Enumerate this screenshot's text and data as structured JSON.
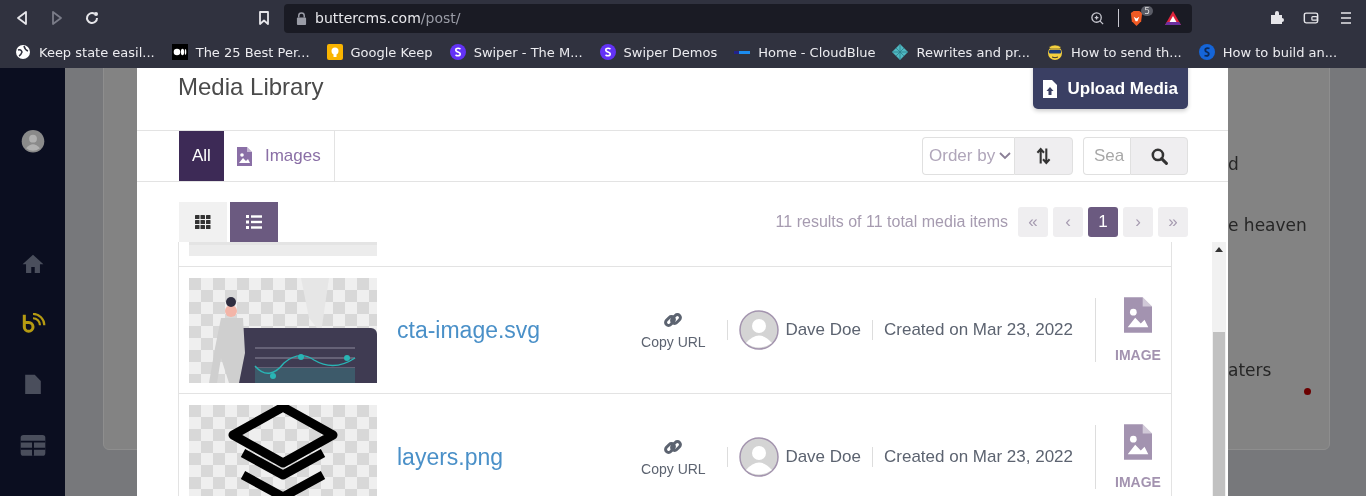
{
  "browser": {
    "url": {
      "host": "buttercms.com",
      "path": "/post/"
    },
    "shields_count": "5",
    "bookmarks": [
      {
        "label": "Keep state easil..."
      },
      {
        "label": "The 25 Best Per..."
      },
      {
        "label": "Google Keep"
      },
      {
        "label": "Swiper - The M..."
      },
      {
        "label": "Swiper Demos"
      },
      {
        "label": "Home - CloudBlue"
      },
      {
        "label": "Rewrites and pr..."
      },
      {
        "label": "How to send th..."
      },
      {
        "label": "How to build an..."
      }
    ]
  },
  "background_page": {
    "right_fragments": [
      "d",
      "e heaven",
      "aters"
    ]
  },
  "modal": {
    "title": "Media Library",
    "upload_button": "Upload Media",
    "tabs": [
      {
        "label": "All",
        "selected": true
      },
      {
        "label": "Images",
        "selected": false
      }
    ],
    "order_by": {
      "value": "Order by"
    },
    "search": {
      "placeholder": "Sea"
    },
    "views": [
      {
        "kind": "grid",
        "selected": false
      },
      {
        "kind": "list",
        "selected": true
      }
    ],
    "results": "11 results of 11 total media items",
    "pagination": [
      {
        "label": "«",
        "selected": false
      },
      {
        "label": "‹",
        "selected": false
      },
      {
        "label": "1",
        "selected": true
      },
      {
        "label": "›",
        "selected": false
      },
      {
        "label": "»",
        "selected": false
      }
    ],
    "items": [
      {
        "name": "cta-image.svg",
        "action": "Copy URL",
        "author": "Dave Doe",
        "created": "Created on Mar 23, 2022",
        "type": "IMAGE"
      },
      {
        "name": "layers.png",
        "action": "Copy URL",
        "author": "Dave Doe",
        "created": "Created on Mar 23, 2022",
        "type": "IMAGE"
      }
    ]
  }
}
